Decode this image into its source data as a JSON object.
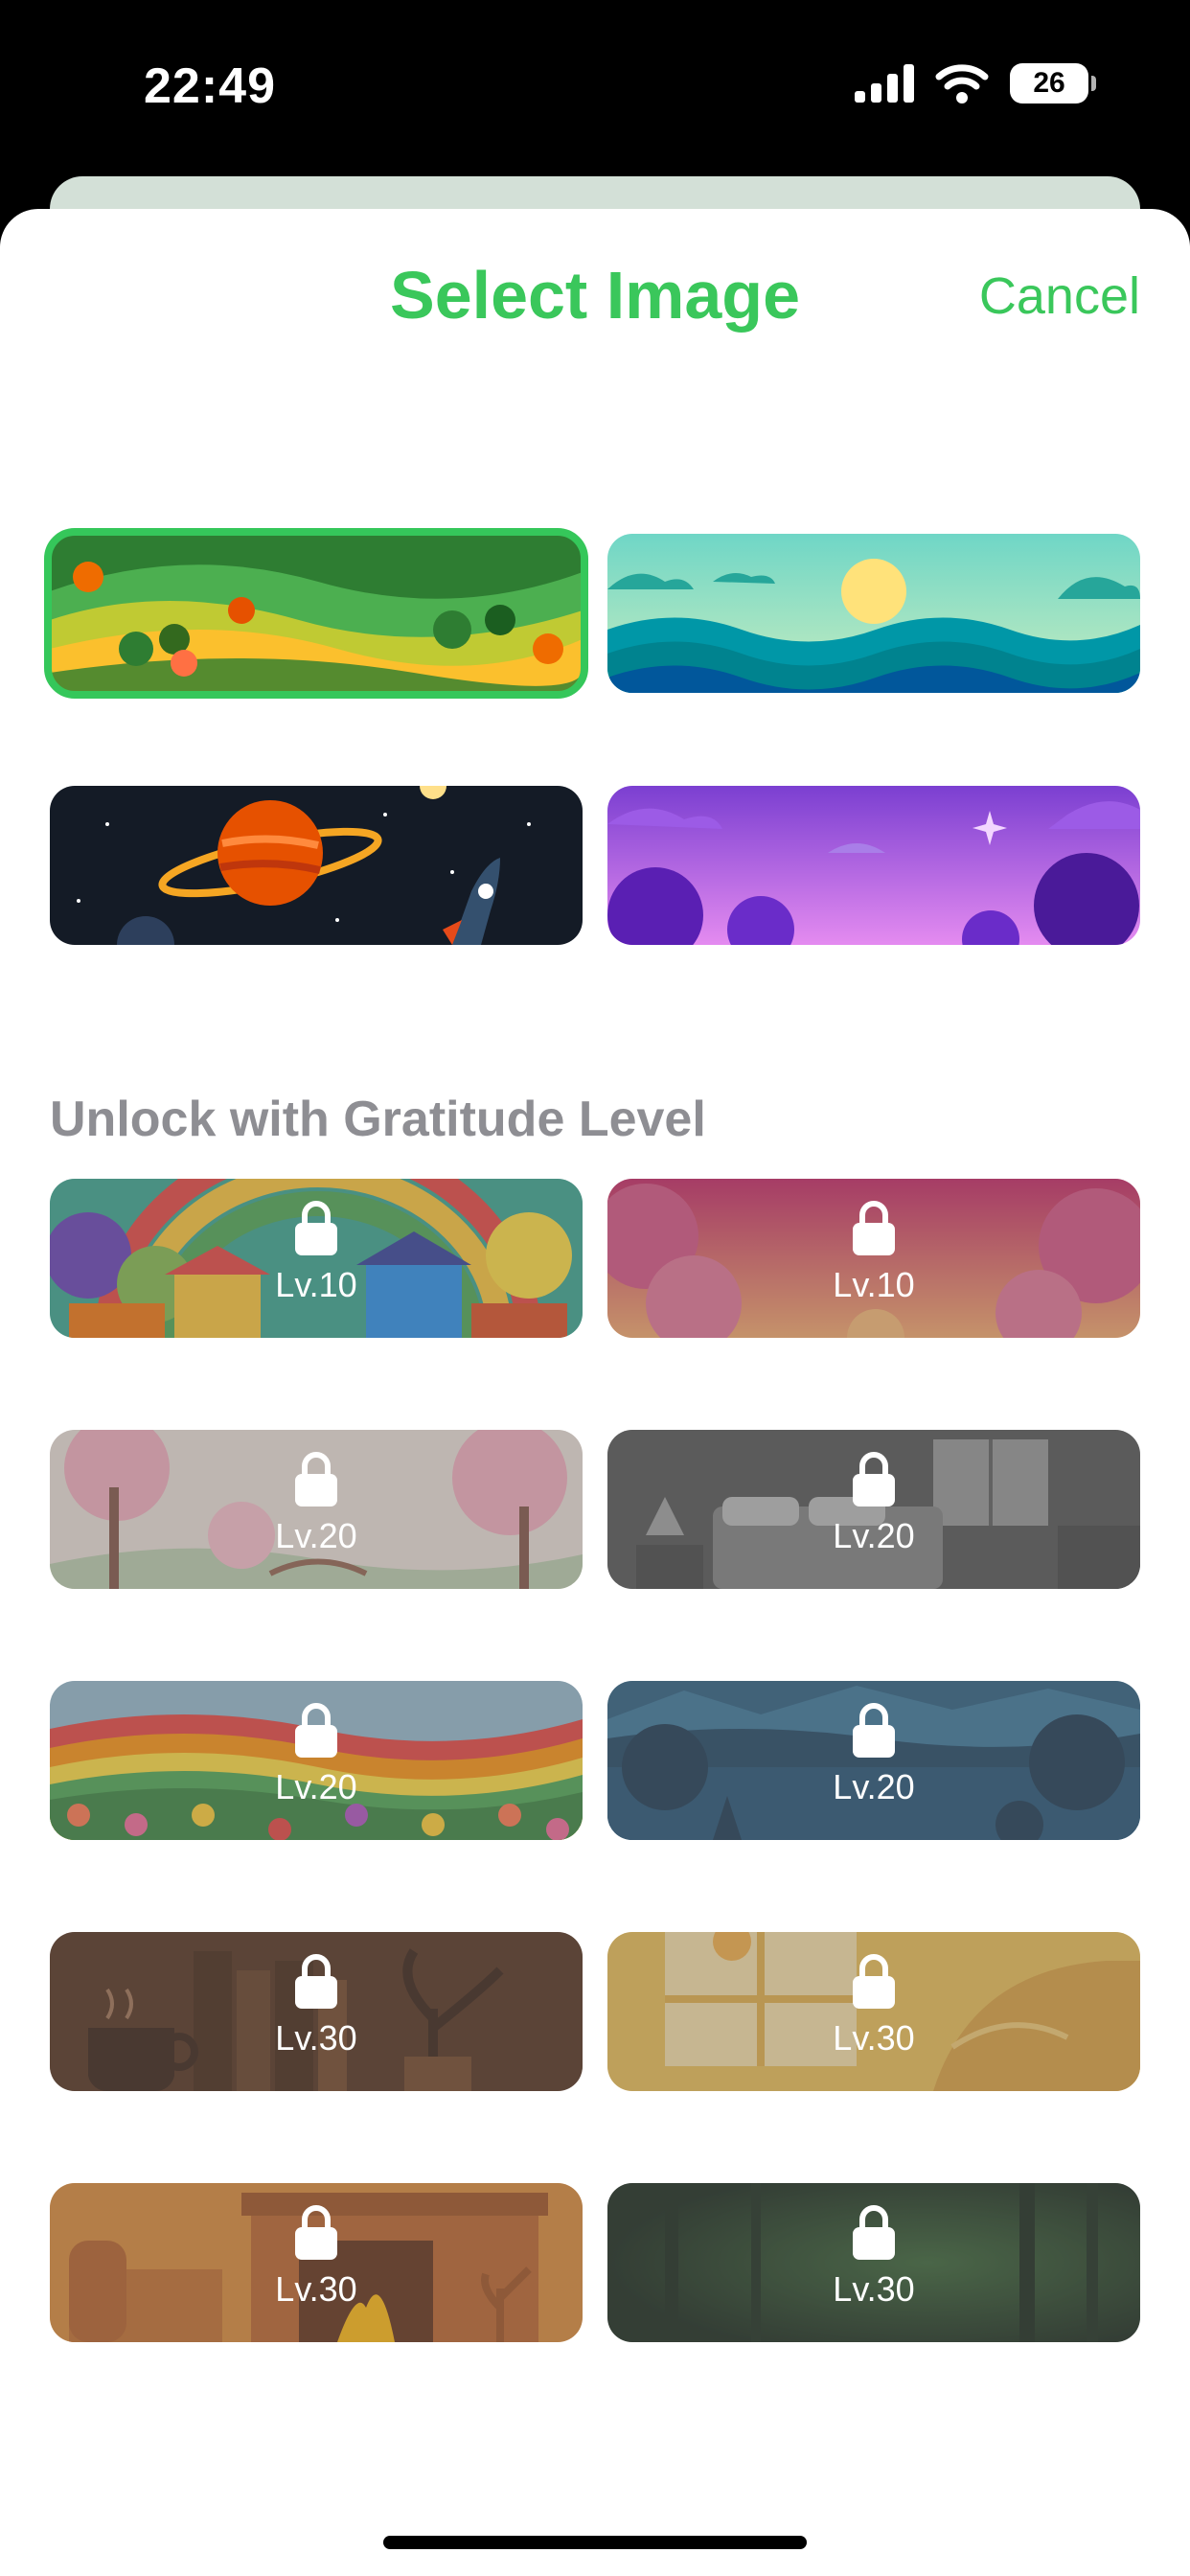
{
  "status_bar": {
    "time": "22:49",
    "battery": "26"
  },
  "sheet": {
    "title": "Select Image",
    "cancel_label": "Cancel"
  },
  "images": [
    {
      "name": "green-hills",
      "selected": true
    },
    {
      "name": "ocean-sunset",
      "selected": false
    },
    {
      "name": "space-planet",
      "selected": false
    },
    {
      "name": "purple-dusk",
      "selected": false
    }
  ],
  "locked_section": {
    "label": "Unlock with Gratitude Level",
    "items": [
      {
        "name": "rainbow-village",
        "level": "Lv.10"
      },
      {
        "name": "pink-clouds",
        "level": "Lv.10"
      },
      {
        "name": "cherry-blossom",
        "level": "Lv.20"
      },
      {
        "name": "bedroom",
        "level": "Lv.20"
      },
      {
        "name": "flower-field",
        "level": "Lv.20"
      },
      {
        "name": "night-lake",
        "level": "Lv.20"
      },
      {
        "name": "coffee-books",
        "level": "Lv.30"
      },
      {
        "name": "sunny-window",
        "level": "Lv.30"
      },
      {
        "name": "fireplace",
        "level": "Lv.30"
      },
      {
        "name": "dark-forest",
        "level": "Lv.30"
      }
    ]
  },
  "colors": {
    "accent": "#3ac75b",
    "label_gray": "#8e8e93"
  }
}
